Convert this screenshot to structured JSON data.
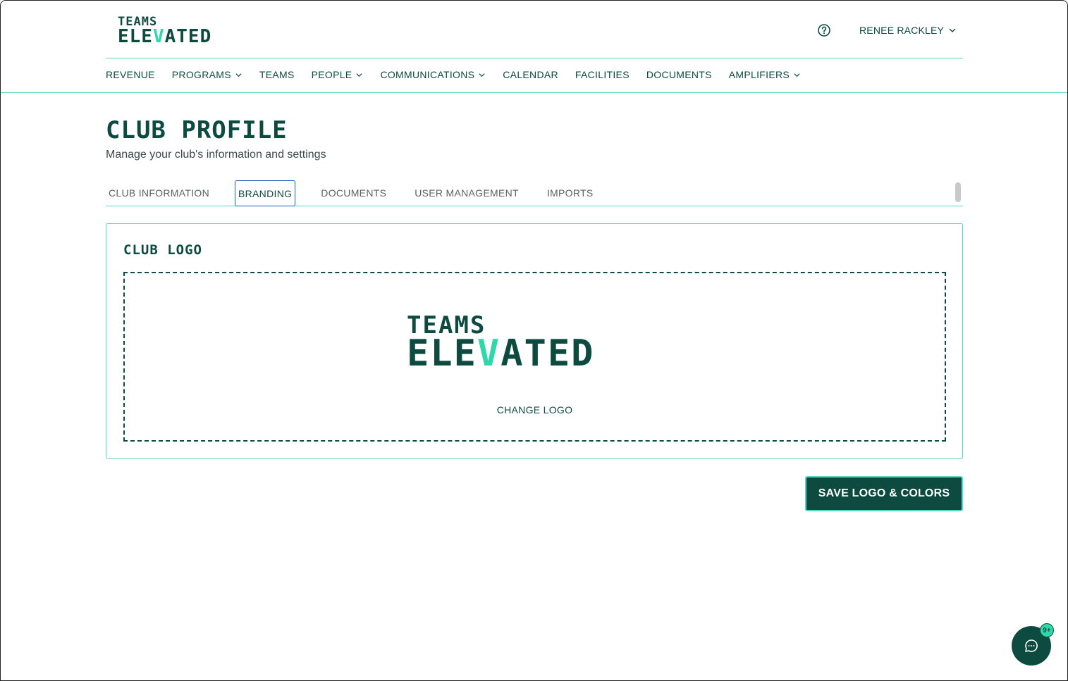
{
  "brand": {
    "logo_top": "TEAMS",
    "logo_bottom_pre": "ELE",
    "logo_bottom_v": "V",
    "logo_bottom_post": "ATED",
    "primary_color": "#0d4a40",
    "accent_color": "#2ed8a8",
    "border_color": "#5cd8c8"
  },
  "header": {
    "help_icon": "question-circle-icon",
    "user_name": "RENEE RACKLEY"
  },
  "nav": {
    "items": [
      {
        "label": "REVENUE"
      },
      {
        "label": "PROGRAMS"
      },
      {
        "label": "TEAMS"
      },
      {
        "label": "PEOPLE"
      },
      {
        "label": "COMMUNICATIONS"
      },
      {
        "label": "CALENDAR"
      },
      {
        "label": "FACILITIES"
      },
      {
        "label": "DOCUMENTS"
      },
      {
        "label": "AMPLIFIERS"
      }
    ]
  },
  "page": {
    "title": "CLUB PROFILE",
    "subtitle": "Manage your club's information and settings"
  },
  "tabs": [
    {
      "label": "CLUB INFORMATION"
    },
    {
      "label": "BRANDING"
    },
    {
      "label": "DOCUMENTS"
    },
    {
      "label": "USER MANAGEMENT"
    },
    {
      "label": "IMPORTS"
    }
  ],
  "club_logo": {
    "title": "CLUB LOGO",
    "change_label": "CHANGE LOGO"
  },
  "actions": {
    "save_label": "SAVE LOGO & COLORS"
  },
  "chat": {
    "icon": "chat-bubble-icon",
    "badge": "9+"
  }
}
